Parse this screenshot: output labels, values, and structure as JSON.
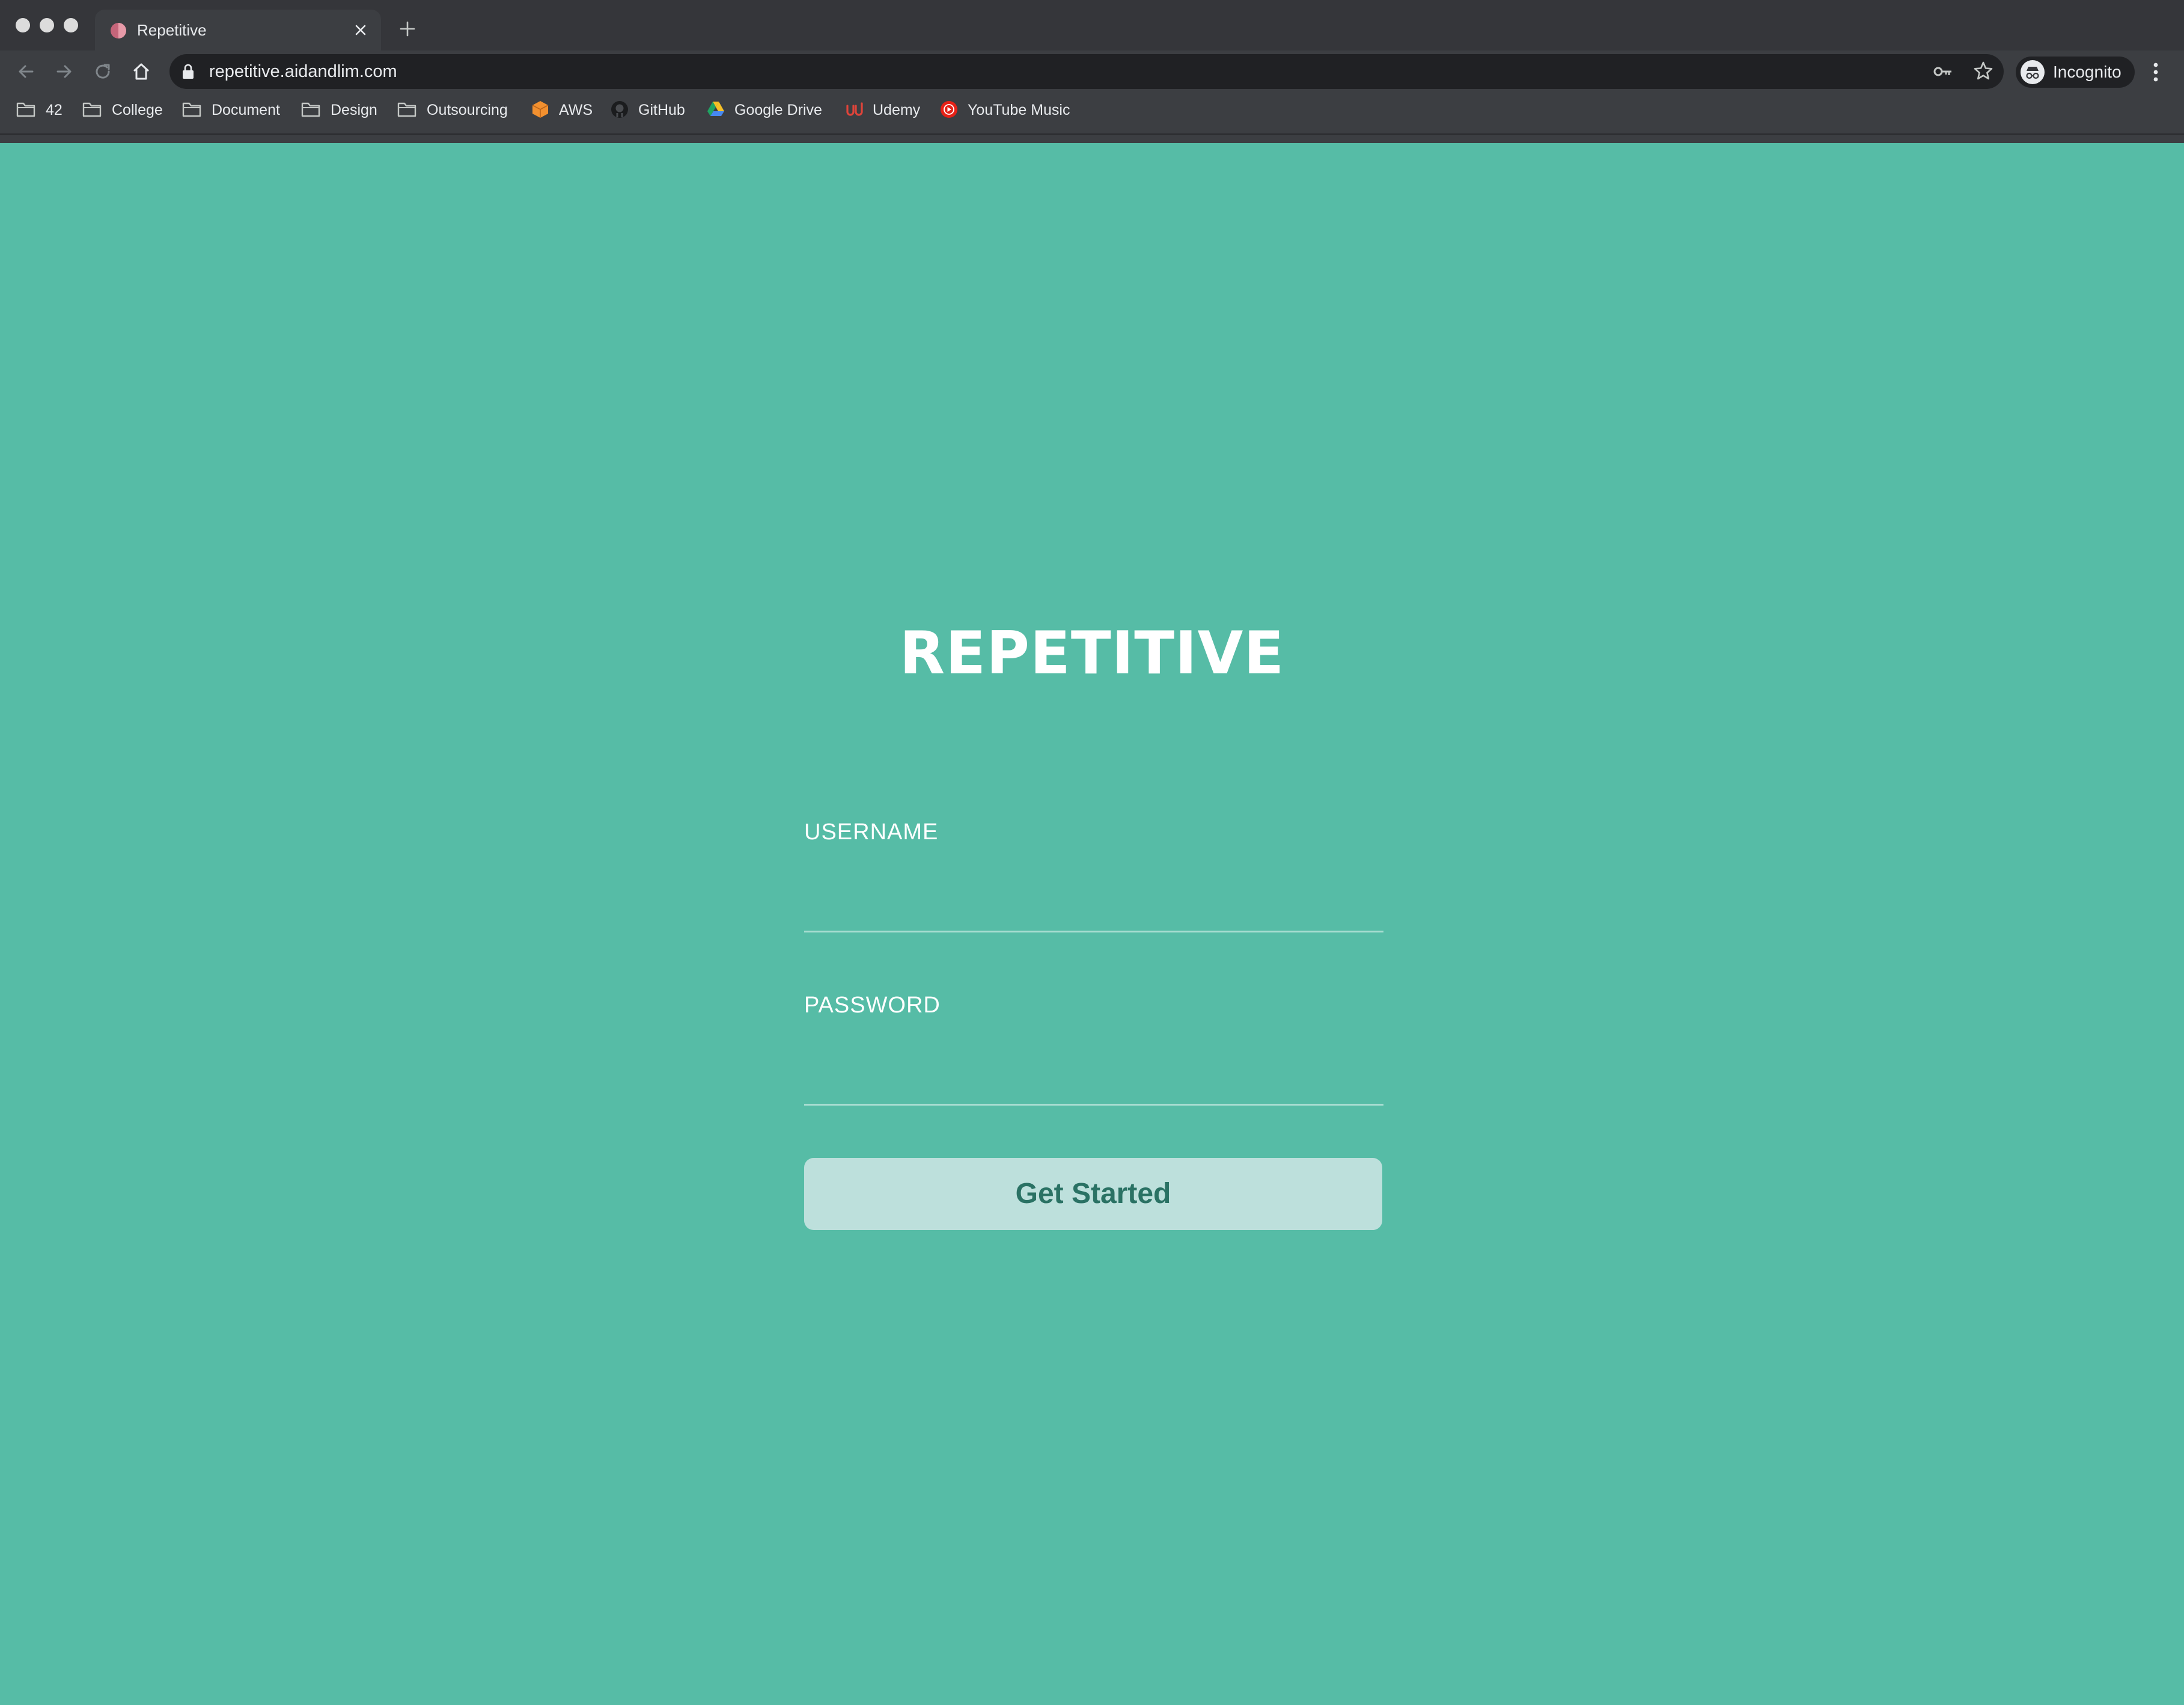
{
  "browser": {
    "tab": {
      "title": "Repetitive"
    },
    "address_bar": {
      "url": "repetitive.aidandlim.com"
    },
    "profile": {
      "label": "Incognito"
    },
    "bookmarks": [
      {
        "label": "42",
        "icon": "folder-icon"
      },
      {
        "label": "College",
        "icon": "folder-icon"
      },
      {
        "label": "Document",
        "icon": "folder-icon"
      },
      {
        "label": "Design",
        "icon": "folder-icon"
      },
      {
        "label": "Outsourcing",
        "icon": "folder-icon"
      },
      {
        "label": "AWS",
        "icon": "aws-icon"
      },
      {
        "label": "GitHub",
        "icon": "github-icon"
      },
      {
        "label": "Google Drive",
        "icon": "google-drive-icon"
      },
      {
        "label": "Udemy",
        "icon": "udemy-icon"
      },
      {
        "label": "YouTube Music",
        "icon": "youtube-music-icon"
      }
    ]
  },
  "page": {
    "brand": "REPETITIVE",
    "login_form": {
      "username_label": "USERNAME",
      "username_value": "",
      "password_label": "PASSWORD",
      "password_value": "",
      "submit_label": "Get Started"
    }
  },
  "colors": {
    "background": "#56bca6",
    "button_background": "#bde0dc",
    "button_text": "#2a7264",
    "chrome_dark": "#35363a"
  }
}
